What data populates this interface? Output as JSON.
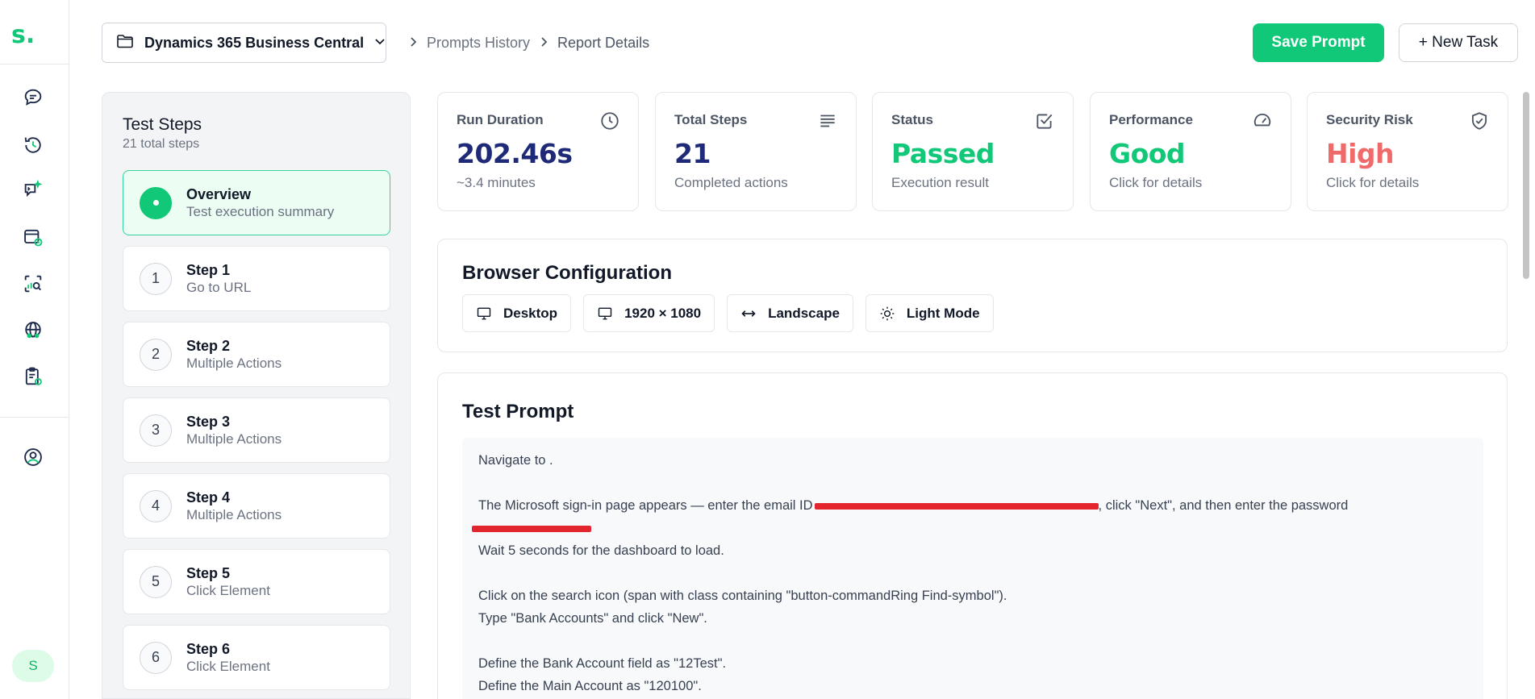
{
  "app": {
    "logo": "s."
  },
  "rail": {
    "icons": [
      "chat-icon",
      "history-icon",
      "ai-chat-icon",
      "calendar-icon",
      "analytics-icon",
      "global-users-icon",
      "clipboard-icon",
      "account-icon"
    ],
    "avatar_initial": "S"
  },
  "header": {
    "project": "Dynamics 365 Business Central",
    "breadcrumb": [
      "Prompts History",
      "Report Details"
    ],
    "save_label": "Save Prompt",
    "new_task_label": "+ New Task"
  },
  "steps": {
    "title": "Test Steps",
    "subtitle": "21 total steps",
    "overview": {
      "title": "Overview",
      "subtitle": "Test execution summary"
    },
    "items": [
      {
        "num": "1",
        "title": "Step 1",
        "subtitle": "Go to URL"
      },
      {
        "num": "2",
        "title": "Step 2",
        "subtitle": "Multiple Actions"
      },
      {
        "num": "3",
        "title": "Step 3",
        "subtitle": "Multiple Actions"
      },
      {
        "num": "4",
        "title": "Step 4",
        "subtitle": "Multiple Actions"
      },
      {
        "num": "5",
        "title": "Step 5",
        "subtitle": "Click Element"
      },
      {
        "num": "6",
        "title": "Step 6",
        "subtitle": "Click Element"
      }
    ]
  },
  "metrics": [
    {
      "label": "Run Duration",
      "value": "202.46s",
      "sub": "~3.4 minutes",
      "icon": "clock-icon",
      "color": "#1e2a78"
    },
    {
      "label": "Total Steps",
      "value": "21",
      "sub": "Completed actions",
      "icon": "list-icon",
      "color": "#1e2a78"
    },
    {
      "label": "Status",
      "value": "Passed",
      "sub": "Execution result",
      "icon": "checkbox-icon",
      "color": "#10c877"
    },
    {
      "label": "Performance",
      "value": "Good",
      "sub": "Click for details",
      "icon": "gauge-icon",
      "color": "#10c877"
    },
    {
      "label": "Security Risk",
      "value": "High",
      "sub": "Click for details",
      "icon": "shield-check-icon",
      "color": "#f06a6a"
    }
  ],
  "browser_config": {
    "title": "Browser Configuration",
    "chips": [
      "Desktop",
      "1920 × 1080",
      "Landscape",
      "Light Mode"
    ]
  },
  "test_prompt": {
    "title": "Test Prompt",
    "line1": "Navigate to .",
    "line2a": "The Microsoft sign-in page appears — enter the email ID",
    "line2b": ", click \"Next\", and then enter the password",
    "line4": "Wait 5 seconds for the dashboard to load.",
    "line5": "Click on the search icon (span with class containing \"button-commandRing Find-symbol\").",
    "line6": "Type \"Bank Accounts\" and click \"New\".",
    "line7": "Define the Bank Account field as \"12Test\".",
    "line8": "Define the Main Account as \"120100\"."
  },
  "colors": {
    "accent": "#10c877",
    "navy": "#1e2a78",
    "danger": "#f06a6a",
    "redaction": "#e3262d"
  }
}
